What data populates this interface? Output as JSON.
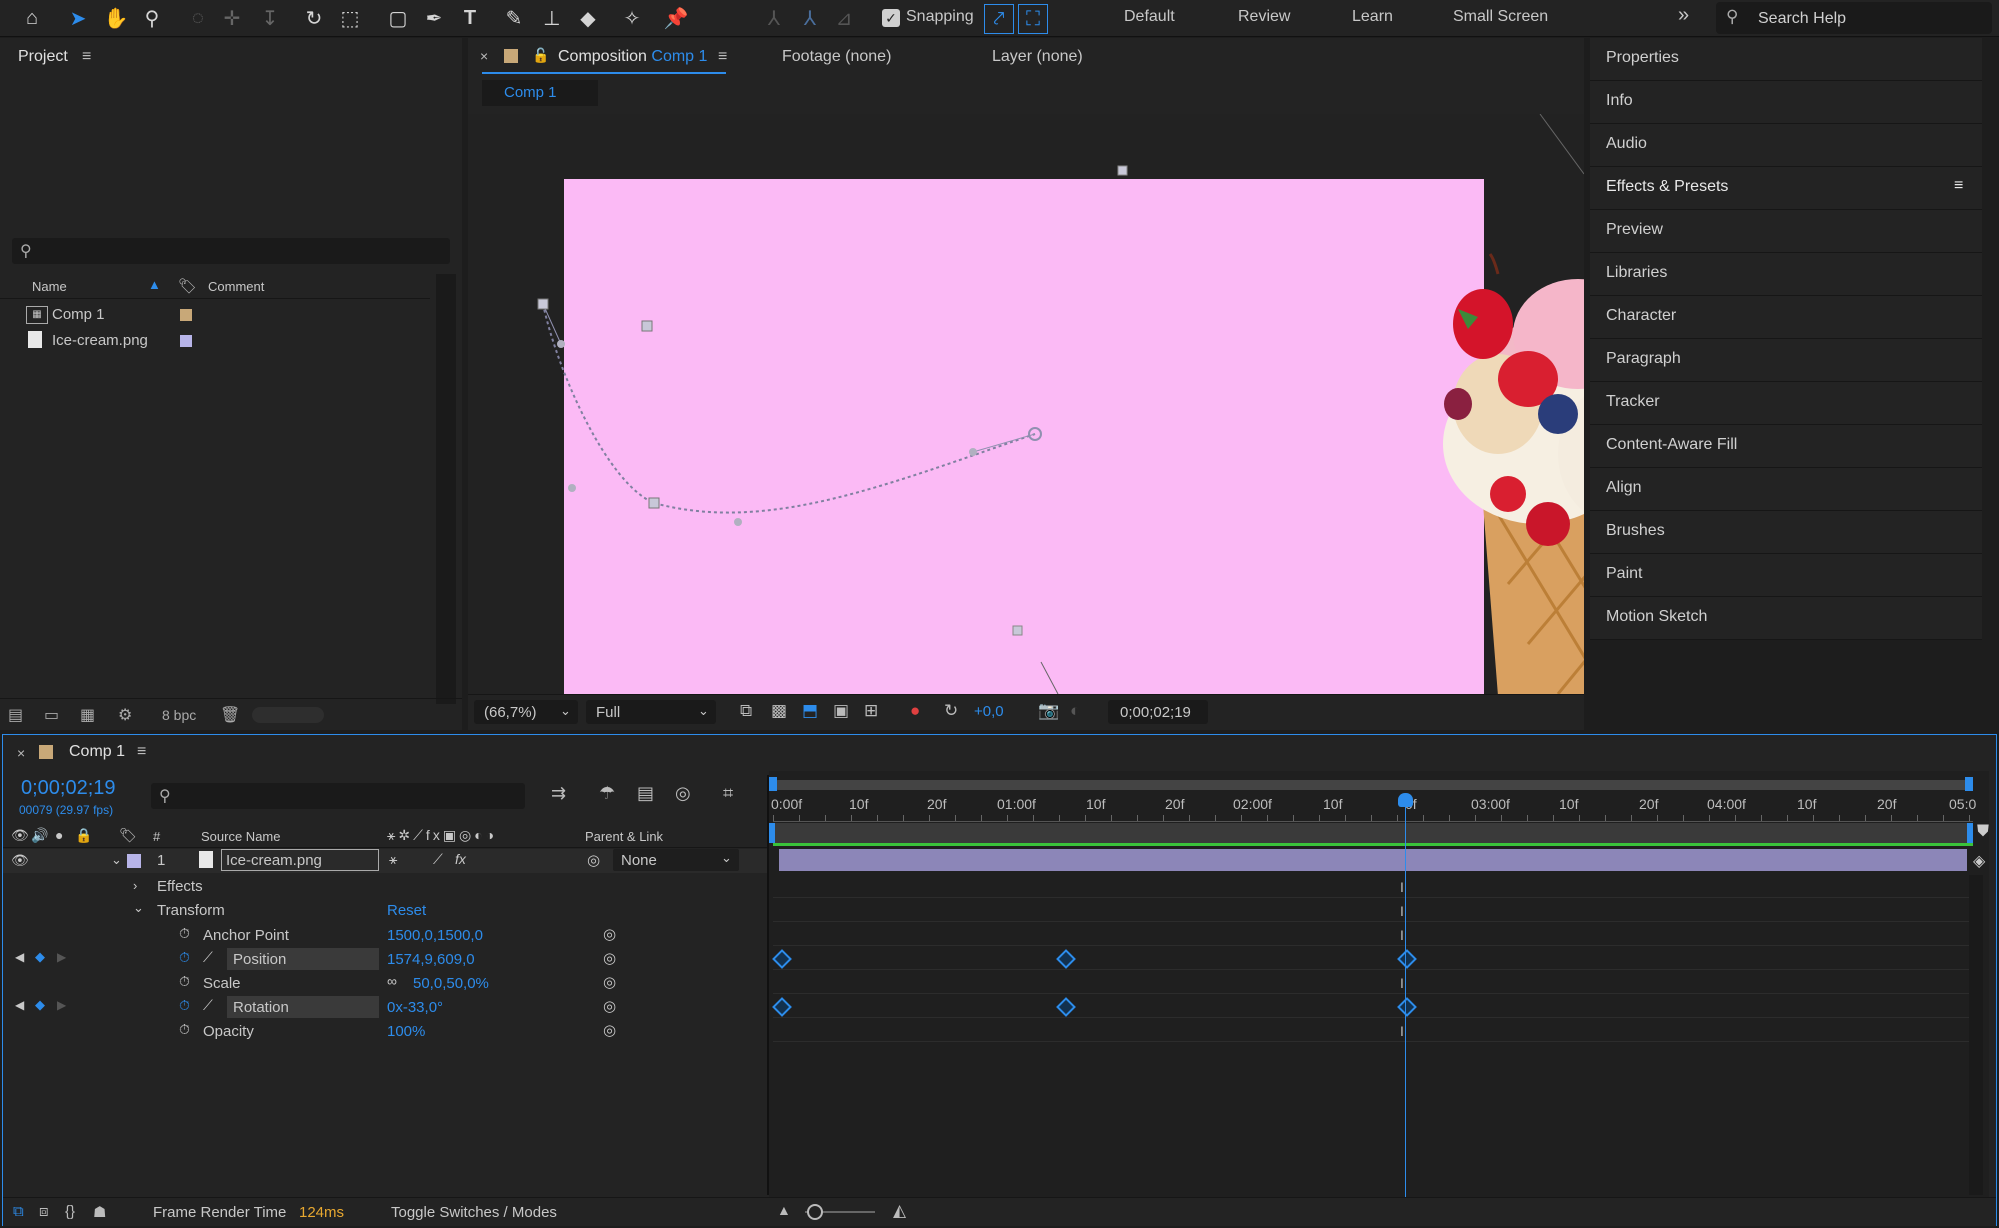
{
  "toolbar": {
    "snapping_label": "Snapping",
    "workspaces": [
      "Default",
      "Review",
      "Learn",
      "Small Screen"
    ],
    "search_placeholder": "Search Help",
    "more_glyph": "»"
  },
  "project": {
    "title": "Project",
    "col_name": "Name",
    "col_comment": "Comment",
    "items": [
      {
        "name": "Comp 1",
        "icon": "composition-icon",
        "label_color": "#c8a878"
      },
      {
        "name": "Ice-cream.png",
        "icon": "image-file-icon",
        "label_color": "#b7b4e8"
      }
    ],
    "bpc": "8 bpc"
  },
  "viewer": {
    "tabs": {
      "composition_prefix": "Composition",
      "composition_name": "Comp 1",
      "footage": "Footage (none)",
      "layer": "Layer (none)"
    },
    "subtab": "Comp 1",
    "zoom": "(66,7%)",
    "resolution": "Full",
    "exposure": "+0,0",
    "timecode": "0;00;02;19",
    "background": "#fbbaf5"
  },
  "right_panel": {
    "items": [
      "Properties",
      "Info",
      "Audio",
      "Effects & Presets",
      "Preview",
      "Libraries",
      "Character",
      "Paragraph",
      "Tracker",
      "Content-Aware Fill",
      "Align",
      "Brushes",
      "Paint",
      "Motion Sketch"
    ]
  },
  "timeline": {
    "tab": "Comp 1",
    "timecode": "0;00;02;19",
    "frames_info": "00079 (29.97 fps)",
    "col_num": "#",
    "col_source": "Source Name",
    "col_parent": "Parent & Link",
    "layer": {
      "index": "1",
      "name": "Ice-cream.png",
      "parent": "None"
    },
    "effects_label": "Effects",
    "transform_label": "Transform",
    "reset_label": "Reset",
    "properties": [
      {
        "name": "Anchor Point",
        "value": "1500,0,1500,0"
      },
      {
        "name": "Position",
        "value": "1574,9,609,0"
      },
      {
        "name": "Scale",
        "value": "50,0,50,0%"
      },
      {
        "name": "Rotation",
        "value": "0x-33,0°"
      },
      {
        "name": "Opacity",
        "value": "100%"
      }
    ],
    "ruler": [
      "0:00f",
      "10f",
      "20f",
      "01:00f",
      "10f",
      "20f",
      "02:00f",
      "10f",
      "0f",
      "03:00f",
      "10f",
      "20f",
      "04:00f",
      "10f",
      "20f",
      "05:0"
    ],
    "footer": {
      "render_label": "Frame Render Time",
      "render_value": "124ms",
      "toggle_label": "Toggle Switches / Modes"
    }
  }
}
